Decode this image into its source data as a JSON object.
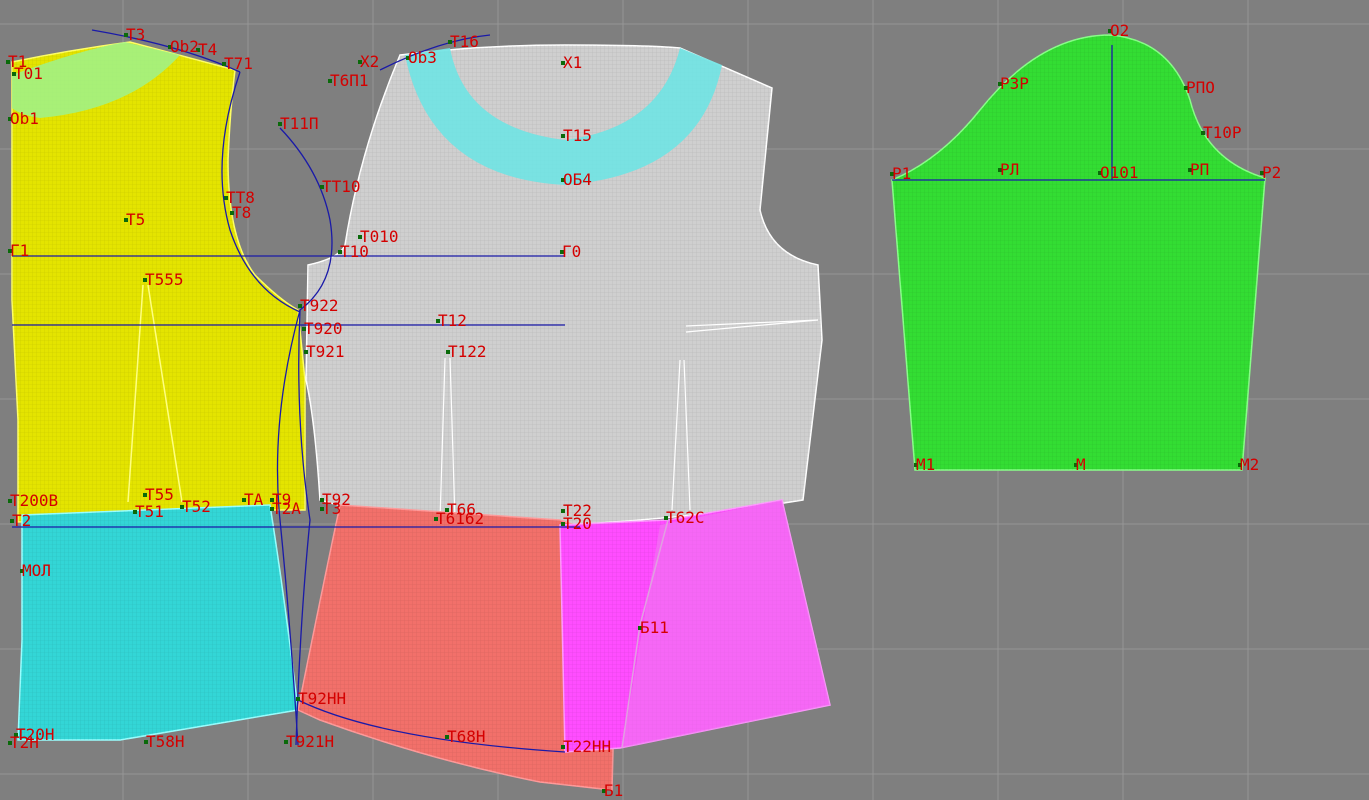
{
  "colors": {
    "background": "#7f7f7f",
    "grid": "#959595",
    "back_bodice": "#e4e400",
    "front_bodice": "#cfcfcf",
    "neck_facing": "#6fe3e3",
    "back_skirt": "#33d6d6",
    "front_skirt": "#f2706a",
    "skirt_side": "#ff4dff",
    "sleeve": "#33dd33",
    "construction_line": "#1a1aa8",
    "label": "#d40000",
    "point": "#0a6a0a"
  },
  "pieces": {
    "back_bodice": "back-bodice-piece",
    "front_bodice": "front-bodice-piece",
    "back_skirt": "back-skirt-piece",
    "front_skirt": "front-skirt-piece",
    "skirt_side": "skirt-side-piece",
    "sleeve": "sleeve-piece"
  },
  "labels": {
    "t1": "T1",
    "t3": "T3",
    "ob2": "Ob2",
    "t4": "T4",
    "t71": "T71",
    "t01": "T01",
    "ob1": "Ob1",
    "t11p": "T11П",
    "tt8": "TT8",
    "t8": "T8",
    "t5": "T5",
    "tt10": "TT10",
    "t010": "T010",
    "g1": "Г1",
    "t10": "T10",
    "g0": "Г0",
    "t555": "T555",
    "t922": "T922",
    "t920": "T920",
    "t921": "T921",
    "t122": "T122",
    "t12": "T12",
    "x2": "X2",
    "ob3": "Ob3",
    "t16": "T16",
    "x1": "X1",
    "t6p1": "T6П1",
    "t15": "T15",
    "ob4": "ОБ4",
    "t200v": "T200B",
    "t55": "T55",
    "t52": "T52",
    "ta": "TA",
    "t9": "T9",
    "t92": "T92",
    "t2": "T2",
    "t51": "T51",
    "t2a": "T2A",
    "t3b": "T3",
    "t66": "T66",
    "t6162": "T6162",
    "t22": "T22",
    "t20": "T20",
    "t62s": "T62C",
    "mol": "МОЛ",
    "b11": "Б11",
    "t92nn": "T92НН",
    "t20n": "T20Н",
    "t2n": "T2Н",
    "t58n": "T58Н",
    "t921n": "T921Н",
    "t68n": "T68Н",
    "t22nn": "T22НН",
    "b1": "Б1",
    "o2": "O2",
    "r3r": "P3P",
    "rpo": "PПО",
    "t10r": "T10P",
    "r1": "P1",
    "rl": "PЛ",
    "o101": "O101",
    "rp": "PП",
    "r2": "P2",
    "m1": "M1",
    "m": "M",
    "m2": "M2"
  }
}
